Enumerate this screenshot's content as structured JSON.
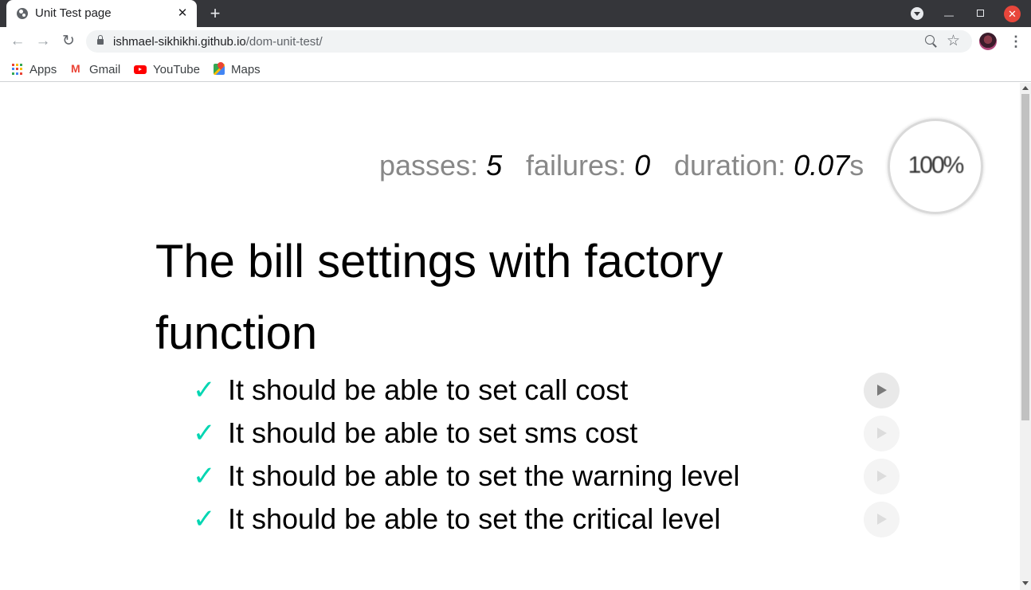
{
  "browser": {
    "tab_title": "Unit Test page",
    "tab_close": "✕",
    "new_tab": "+",
    "url_host": "ishmael-sikhikhi.github.io",
    "url_path": "/dom-unit-test/",
    "bookmarks": [
      {
        "label": "Apps",
        "icon": "apps-grid-icon"
      },
      {
        "label": "Gmail",
        "icon": "gmail-icon"
      },
      {
        "label": "YouTube",
        "icon": "youtube-icon"
      },
      {
        "label": "Maps",
        "icon": "maps-icon"
      }
    ]
  },
  "report": {
    "passes_label": "passes: ",
    "passes_value": "5",
    "failures_label": "failures: ",
    "failures_value": "0",
    "duration_label": "duration: ",
    "duration_value": "0.07",
    "duration_unit": "s",
    "progress_text": "100%",
    "progress_percent": 100
  },
  "suite": {
    "title": "The bill settings with factory function",
    "tests": [
      {
        "status": "pass",
        "check": "✓",
        "title": "It should be able to set call cost"
      },
      {
        "status": "pass",
        "check": "✓",
        "title": "It should be able to set sms cost"
      },
      {
        "status": "pass",
        "check": "✓",
        "title": "It should be able to set the warning level"
      },
      {
        "status": "pass",
        "check": "✓",
        "title": "It should be able to set the critical level"
      }
    ]
  },
  "colors": {
    "pass_check": "#00d6b2",
    "stat_label": "#888888",
    "close_button": "#e8463b"
  }
}
